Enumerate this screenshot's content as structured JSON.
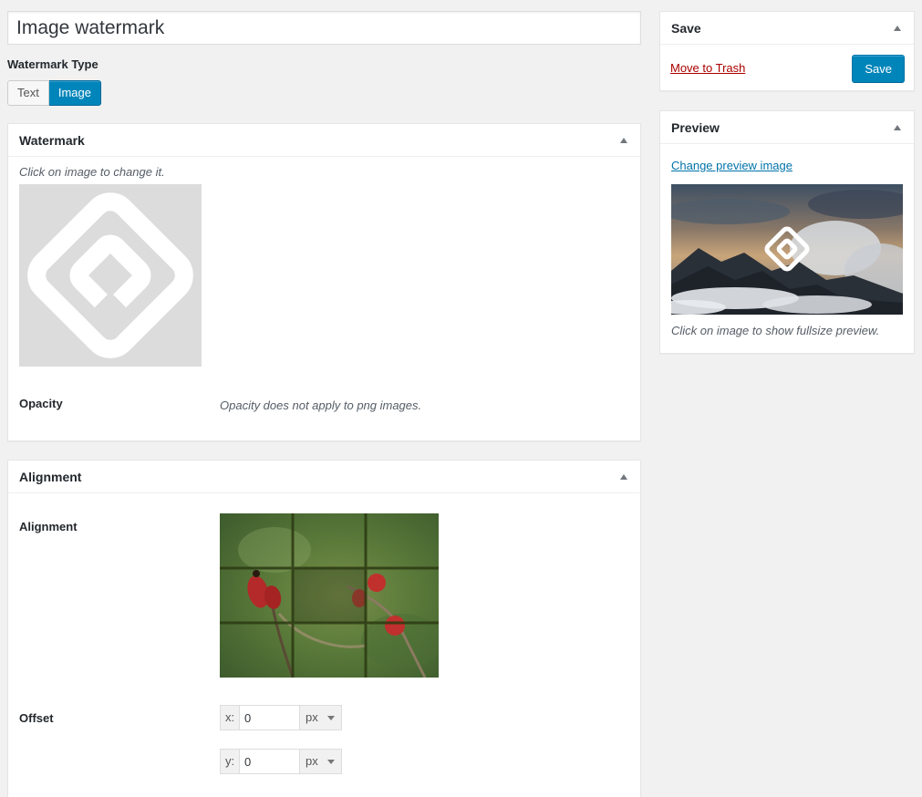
{
  "title": {
    "value": "Image watermark"
  },
  "watermark_type": {
    "label": "Watermark Type",
    "options": [
      "Text",
      "Image"
    ],
    "selected": "Image"
  },
  "watermark_box": {
    "heading": "Watermark",
    "hint": "Click on image to change it.",
    "image_icon": "watermark-logo-icon",
    "opacity_label": "Opacity",
    "opacity_note": "Opacity does not apply to png images."
  },
  "alignment_box": {
    "heading": "Alignment",
    "alignment_label": "Alignment",
    "selected_cell": "center",
    "offset_label": "Offset",
    "offset_x": {
      "prefix": "x:",
      "value": "0",
      "unit": "px"
    },
    "offset_y": {
      "prefix": "y:",
      "value": "0",
      "unit": "px"
    }
  },
  "save_box": {
    "heading": "Save",
    "trash_label": "Move to Trash",
    "save_label": "Save"
  },
  "preview_box": {
    "heading": "Preview",
    "change_label": "Change preview image",
    "hint": "Click on image to show fullsize preview."
  },
  "colors": {
    "accent": "#0085ba",
    "trash": "#aa0000",
    "link": "#0073aa"
  }
}
